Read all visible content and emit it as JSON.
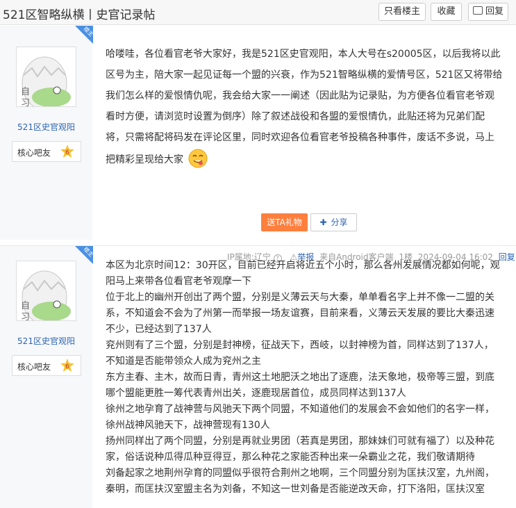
{
  "header": {
    "title": "521区智略纵横丨史官记录帖",
    "only_op_label": "只看楼主",
    "favorite_label": "收藏",
    "reply_label": "回复"
  },
  "posts": [
    {
      "author": "521区史官观阳",
      "badge": "核心吧友",
      "level": "6",
      "ribbon": "楼主",
      "lines": [
        "哈喽哇，各位看官老爷大家好，我是521区史官观阳，本人大号在s20005区，以后我将以此",
        "区号为主，陪大家一起见证每一个盟的兴衰，作为521智略纵横的爱情号区，521区又将带给",
        "我们怎么样的爱恨情仇呢，我会给大家一一阐述（因此贴为记录贴，为方便各位看官老爷观",
        "看时方便，请浏览时设置为倒序）除了叙述战役和各盟的爱恨情仇，此贴还将为兄弟们配",
        "将，只需将配将码发在评论区里，同时欢迎各位看官老爷投稿各种事件，废话不多说，马上",
        "把精彩呈现给大家"
      ],
      "gift_label": "送TA礼物",
      "share_label": "分享",
      "ip": "IP属地:辽宁",
      "report": "举报",
      "client": "来自Android客户端",
      "floor": "1楼",
      "time": "2024-09-04 16:02",
      "reply": "回复"
    },
    {
      "author": "521区史官观阳",
      "badge": "核心吧友",
      "level": "6",
      "ribbon": "楼主",
      "lines": [
        "本区为北京时间12：30开区，目前已经开启将近五个小时，那么各州发展情况都如何呢，观",
        "阳马上来带各位看官老爷观摩一下",
        "位于北上的幽州开创出了两个盟，分别是义薄云天与大秦，单单看名字上并不像一二盟的关",
        "系，不知道会不会为了州第一而举报一场友谊赛，目前来看，义薄云天发展的要比大秦迅速",
        "不少，已经达到了137人",
        "兖州则有了三个盟，分别是封神榜，征战天下，西岐，以封神榜为首，同样达到了137人，",
        "不知道是否能带领众人成为兖州之主",
        "东方主春、主木，故而日青，青州这土地肥沃之地出了逐鹿，法天象地，极帝等三盟，到底",
        "哪个盟能更胜一筹代表青州出关，逐鹿现居首位，成员同样达到137人",
        "徐州之地孕育了战神营与风驰天下两个同盟，不知道他们的发展会不会如他们的名字一样，",
        "徐州战神风驰天下，战神营现有130人",
        "扬州同样出了两个同盟，分别是再就业男团（若真是男团，那妹妹们可就有福了）以及种花",
        "家，俗话说种瓜得瓜种豆得豆，那么种花之家能否种出来一朵霸业之花，我们敬请期待",
        "刘备起家之地荆州孕育的同盟似乎很符合荆州之地啊，三个同盟分别为匡扶汉室，九州阁，",
        "秦明，而匡扶汉室盟主名为刘备，不知这一世刘备是否能逆改天命，打下洛阳，匡扶汉室"
      ]
    }
  ],
  "colors": {
    "accent": "#2d64b3",
    "gift": "#ff7f3e",
    "ribbon": "#4a90e2"
  }
}
